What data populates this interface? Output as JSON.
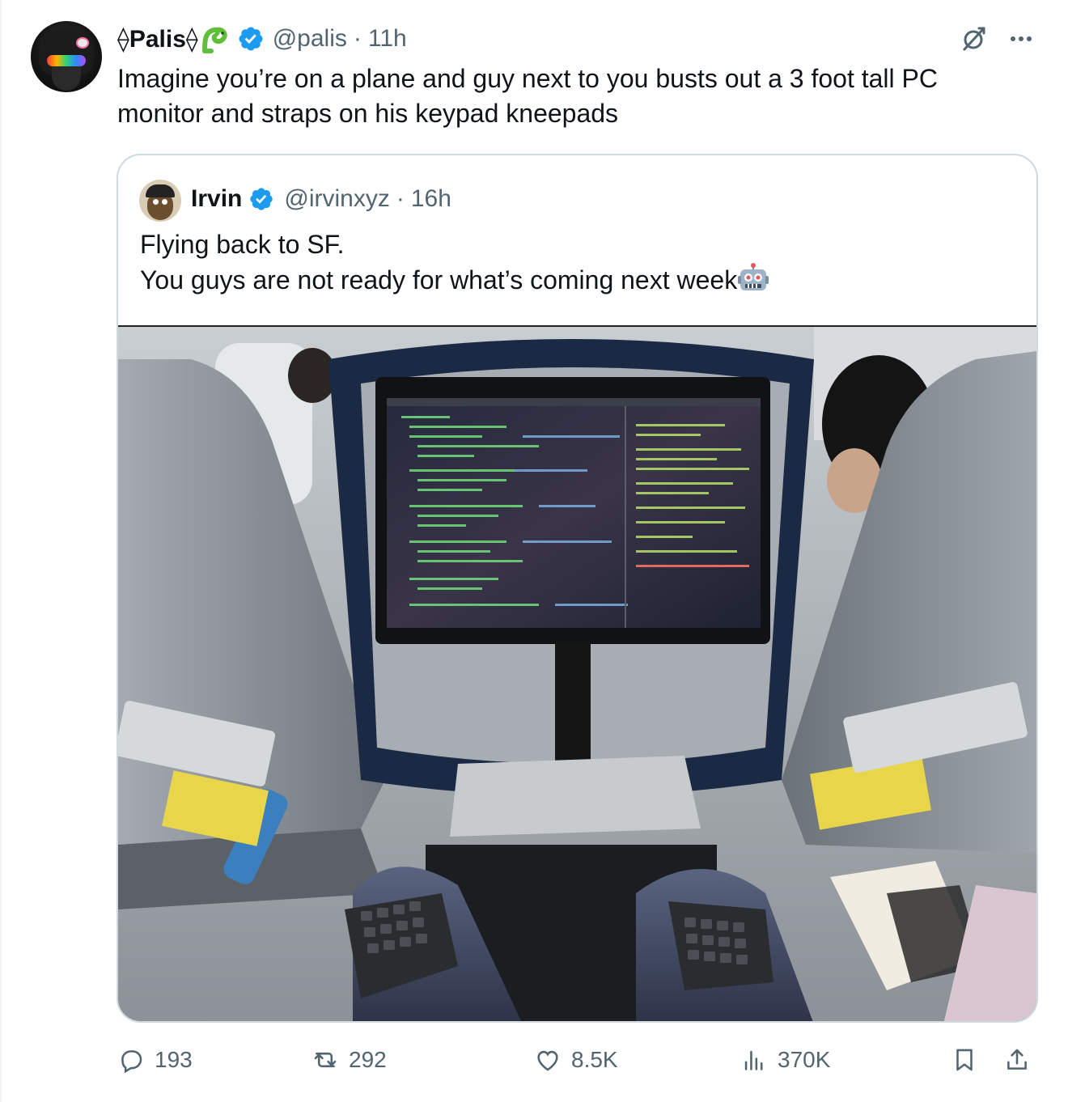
{
  "tweet": {
    "author_name": "⟠Palis⟠",
    "handle": "@palis",
    "separator": "·",
    "time": "11h",
    "text": "Imagine you’re on a plane and guy next to you busts out a 3 foot tall PC\nmonitor and straps on his keypad kneepads"
  },
  "quoted": {
    "author_name": "Irvin",
    "handle": "@irvinxyz",
    "separator": "·",
    "time": "16h",
    "line1": "Flying back to SF.",
    "line2": "You guys are not ready for what’s coming next week"
  },
  "actions": {
    "replies": "193",
    "reposts": "292",
    "likes": "8.5K",
    "views": "370K"
  },
  "icons": {
    "avatar": "avatar-icon",
    "snake": "snake-emoji-icon",
    "verified": "verified-badge-icon",
    "grok": "grok-icon",
    "more": "more-icon",
    "robot": "robot-emoji-icon",
    "reply": "reply-icon",
    "repost": "repost-icon",
    "like": "heart-icon",
    "views": "views-icon",
    "bookmark": "bookmark-icon",
    "share": "share-icon"
  },
  "colors": {
    "verified": "#1d9bf0",
    "secondary_text": "#536471",
    "border": "#cfd9de"
  }
}
